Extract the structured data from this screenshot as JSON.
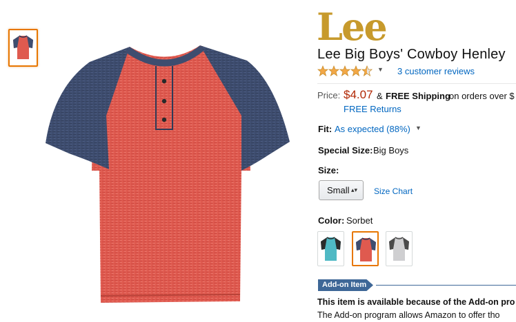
{
  "brand": {
    "logo_text": "Lee"
  },
  "product": {
    "title": "Lee Big Boys' Cowboy Henley",
    "rating": 4.5,
    "rating_max": 5,
    "reviews_link": "3 customer reviews"
  },
  "price": {
    "label": "Price:",
    "value": "$4.07",
    "amp": "&",
    "free_shipping": "FREE Shipping",
    "shipping_rest": "on orders over $",
    "free_returns": "FREE Returns"
  },
  "fit": {
    "label": "Fit:",
    "value": "As expected (88%)"
  },
  "special_size": {
    "label": "Special Size:",
    "value": "Big Boys"
  },
  "size": {
    "label": "Size:",
    "selected": "Small",
    "size_chart": "Size Chart"
  },
  "color": {
    "label": "Color:",
    "value": "Sorbet",
    "swatches": [
      {
        "name": "teal",
        "body": "#4fb9c4",
        "sleeve": "#2b2b2b"
      },
      {
        "name": "Sorbet",
        "body": "#df5a4f",
        "sleeve": "#3e4d6f"
      },
      {
        "name": "grey",
        "body": "#cfcfd1",
        "sleeve": "#4a4a4a"
      }
    ]
  },
  "addon": {
    "badge": "Add-on Item",
    "heading": "This item is available because of the Add-on pro",
    "description": "The Add-on program allows Amazon to offer tho"
  },
  "colors": {
    "link": "#0066c0",
    "price": "#b12704",
    "selected_border": "#e77600",
    "logo": "#c79a2c",
    "addon_badge": "#3e6797",
    "shirt_body": "#df5a4f",
    "shirt_sleeve": "#3e4d6f"
  }
}
